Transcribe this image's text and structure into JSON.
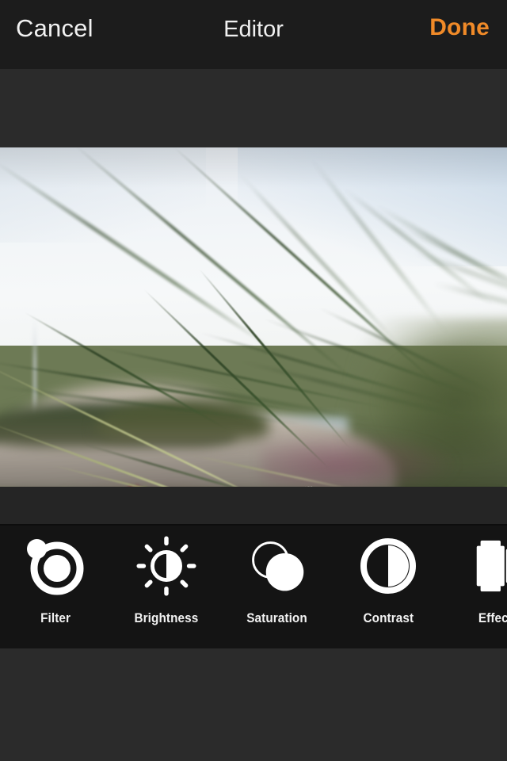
{
  "header": {
    "cancel_label": "Cancel",
    "title": "Editor",
    "done_label": "Done",
    "done_color": "#f08a28",
    "background": "#1c1c1c"
  },
  "photo": {
    "alt": "Close-up of yellow ice plant flower among green and red succulent leaves on a sand dune with beach grass and pale sky",
    "background": "#2b2b2b"
  },
  "toolbar": {
    "background": "#141414",
    "items": [
      {
        "label": "Filter",
        "icon": "filter-icon"
      },
      {
        "label": "Brightness",
        "icon": "brightness-icon"
      },
      {
        "label": "Saturation",
        "icon": "saturation-icon"
      },
      {
        "label": "Contrast",
        "icon": "contrast-icon"
      },
      {
        "label": "Effects",
        "icon": "effects-film-icon"
      }
    ]
  },
  "footer": {
    "background": "#2b2b2b"
  }
}
